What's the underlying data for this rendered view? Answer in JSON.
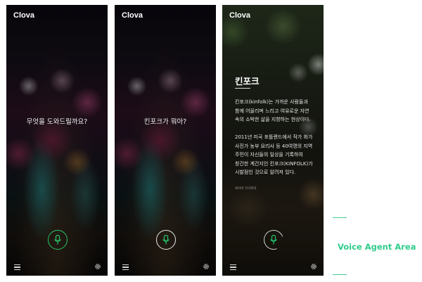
{
  "screens": [
    {
      "app_title": "Clova",
      "query": "무엇을 도와드릴까요?",
      "mic_state": "listening",
      "mic_color": "#27c46b"
    },
    {
      "app_title": "Clova",
      "query": "킨포크가 뭐아?",
      "mic_state": "listening",
      "mic_color": "#27c46b"
    },
    {
      "app_title": "Clova",
      "card": {
        "title": "킨포크",
        "paragraph1": "킨포크(kinfolk)는 가까운 사람들과\n함께 어울리며 느리고 여유로운 자연\n속의 소박한 삶을 지향하는 현상이다.",
        "paragraph2": "2011년 미국 포틀랜드에서 작가 화가\n사진가 농부 요리사 등 40여명의 지역\n주민이 자신들의 일상을 기록하여\n창간한 계간지인 킨포크(KINFOLK)가\n시발점인 것으로 알려져 있다.",
        "source": "네이버 지식백과"
      },
      "mic_state": "processing"
    }
  ],
  "icons": {
    "mic": "microphone-icon",
    "menu": "hamburger-menu-icon",
    "settings": "gear-icon"
  },
  "annotation": {
    "label": "Voice Agent Area",
    "color": "#2ecc8a"
  }
}
